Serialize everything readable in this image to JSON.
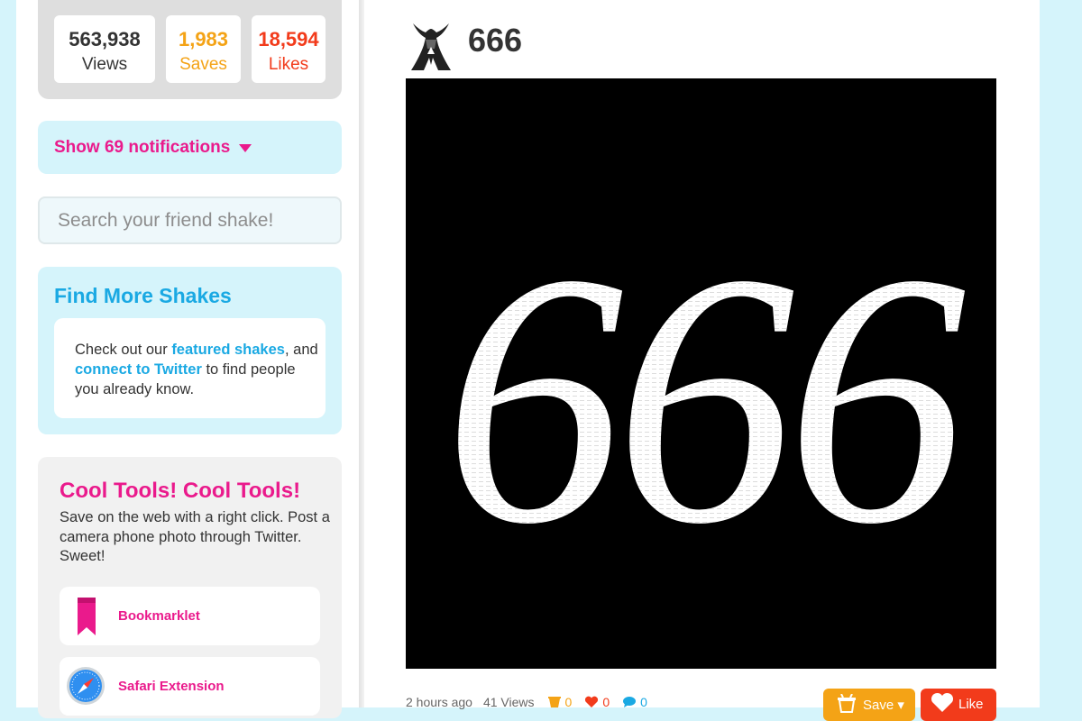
{
  "stats": {
    "views_count": "563,938",
    "views_label": "Views",
    "saves_count": "1,983",
    "saves_label": "Saves",
    "likes_count": "18,594",
    "likes_label": "Likes"
  },
  "notifications": {
    "label": "Show 69 notifications"
  },
  "search": {
    "placeholder": "Search your friend shake!"
  },
  "find_more": {
    "title": "Find More Shakes",
    "text_1": "Check out our ",
    "link_featured": "featured shakes",
    "text_2": ", and ",
    "link_twitter": "connect to Twitter",
    "text_3": " to find people you already know."
  },
  "tools": {
    "title": "Cool Tools! Cool Tools!",
    "description": "Save on the web with a right click. Post a camera phone photo through Twitter. Sweet!",
    "items": [
      {
        "label": "Bookmarklet",
        "icon": "bookmark-ribbon-icon"
      },
      {
        "label": "Safari Extension",
        "icon": "safari-compass-icon"
      }
    ]
  },
  "post": {
    "title": "666",
    "image_text": "666",
    "time_ago": "2 hours ago",
    "views": "41 Views",
    "saves_count": "0",
    "likes_count": "0",
    "comments_count": "0",
    "save_label": "Save ▾",
    "like_label": "Like"
  },
  "colors": {
    "pink": "#ea1a8c",
    "cyan": "#1aa9e3",
    "orange": "#f4a316",
    "red": "#f23b1b",
    "light_blue_bg": "#d5f4fb"
  }
}
